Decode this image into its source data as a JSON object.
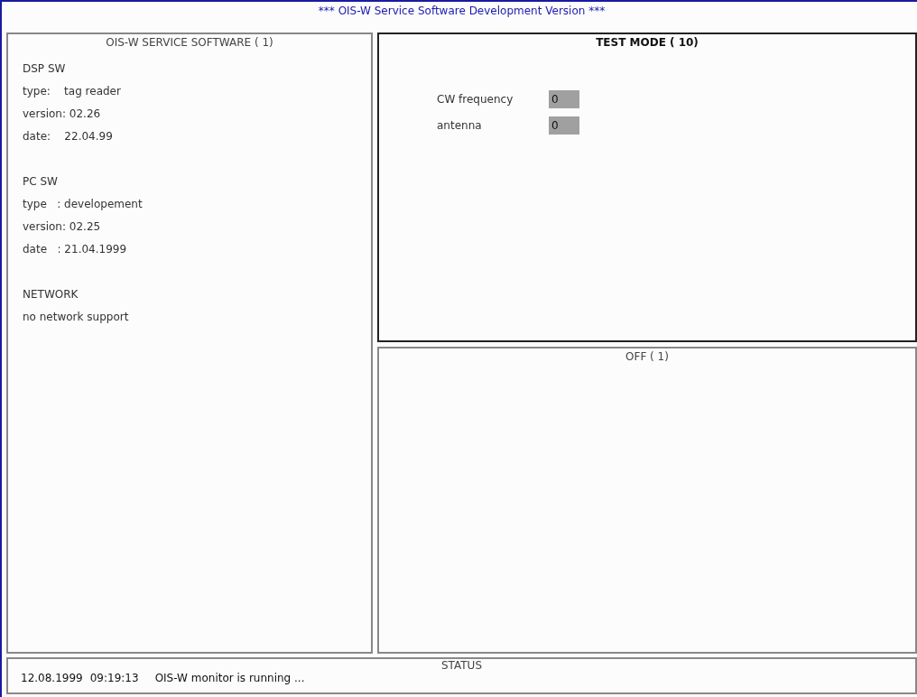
{
  "window": {
    "title": "*** OIS-W Service Software Development Version ***"
  },
  "info_panel": {
    "title": "OIS-W SERVICE SOFTWARE ( 1)",
    "active": false,
    "sections": [
      {
        "heading": "DSP SW",
        "lines": [
          "type:    tag reader",
          "version: 02.26",
          "date:    22.04.99"
        ]
      },
      {
        "heading": "PC SW",
        "lines": [
          "type   : developement",
          "version: 02.25",
          "date   : 21.04.1999"
        ]
      },
      {
        "heading": "NETWORK",
        "lines": [
          "no network support"
        ]
      }
    ]
  },
  "test_panel": {
    "title": "TEST MODE ( 10)",
    "active": true,
    "fields": [
      {
        "label": "CW frequency",
        "value": "0"
      },
      {
        "label": "antenna",
        "value": "0"
      }
    ]
  },
  "off_panel": {
    "title": "OFF ( 1)",
    "active": false
  },
  "status_bar": {
    "title": "STATUS",
    "date": "12.08.1999",
    "time": "09:19:13",
    "message": "OIS-W monitor is running ..."
  }
}
